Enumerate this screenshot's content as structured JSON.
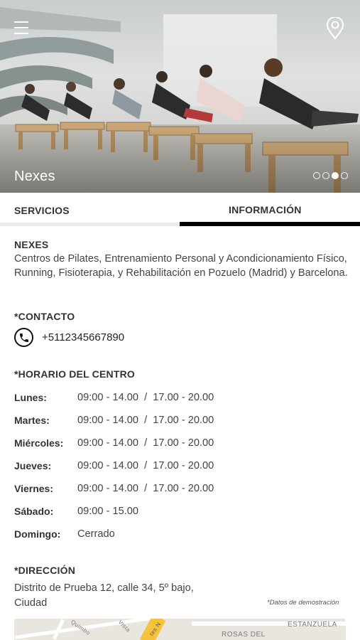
{
  "hero": {
    "title": "Nexes",
    "slides": {
      "count": 4,
      "active": 3
    }
  },
  "tabs": [
    {
      "label": "SERVICIOS",
      "active": false
    },
    {
      "label": "INFORMACIÓN",
      "active": true
    }
  ],
  "info": {
    "name": "NEXES",
    "description": "Centros de Pilates, Entrenamiento Personal y Acondicionamiento Físico, Running, Fisioterapia, y Rehabilitación en Pozuelo (Madrid) y Barcelona."
  },
  "contact": {
    "heading": "*CONTACTO",
    "phone": "+5112345667890",
    "icon": "phone-icon"
  },
  "schedule": {
    "heading": "*HORARIO DEL CENTRO",
    "rows": [
      {
        "day": "Lunes:",
        "hours": "09:00 - 14.00  /  17.00 - 20.00"
      },
      {
        "day": "Martes:",
        "hours": "09:00 - 14.00  /  17.00 - 20.00"
      },
      {
        "day": "Miércoles:",
        "hours": "09:00 - 14.00  /  17.00 - 20.00"
      },
      {
        "day": "Jueves:",
        "hours": "09:00 - 14.00  /  17.00 - 20.00"
      },
      {
        "day": "Viernes:",
        "hours": "09:00 - 14.00  /  17.00 - 20.00"
      },
      {
        "day": "Sábado:",
        "hours": "09:00 - 15.00"
      },
      {
        "day": "Domingo:",
        "hours": "Cerrado"
      }
    ]
  },
  "address": {
    "heading": "*DIRECCIÓN",
    "text": "Distrito de Prueba 12, calle 34, 5º bajo, Ciudad",
    "note": "*Datos de demostración"
  },
  "map": {
    "labels": [
      "ROSAS DEL",
      "ESTANZUELA",
      "Quimbo",
      "Vista",
      "tes N"
    ]
  },
  "colors": {
    "accent": "#000000",
    "tab_inactive_bar": "#ebebeb",
    "map_road": "#f5c33b"
  }
}
